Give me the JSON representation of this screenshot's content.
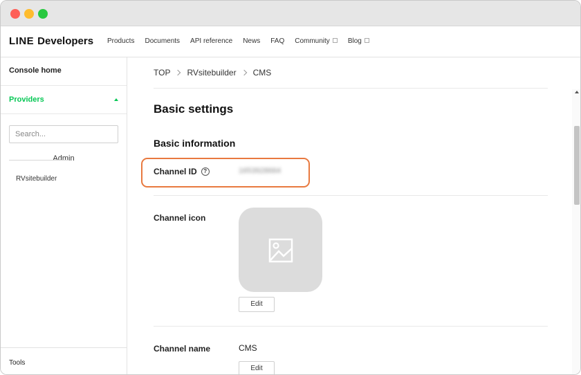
{
  "nav": {
    "logo_line": "LINE",
    "logo_dev": "Developers",
    "links": [
      "Products",
      "Documents",
      "API reference",
      "News",
      "FAQ",
      "Community",
      "Blog"
    ]
  },
  "sidebar": {
    "console_home": "Console home",
    "providers": "Providers",
    "search_placeholder": "Search...",
    "section": "Admin",
    "items": [
      "RVsitebuilder"
    ],
    "tools": "Tools"
  },
  "breadcrumb": [
    "TOP",
    "RVsitebuilder",
    "CMS"
  ],
  "page": {
    "title": "Basic settings",
    "section": "Basic information",
    "channel_id_label": "Channel ID",
    "channel_id_value": "1653928664",
    "channel_icon_label": "Channel icon",
    "edit_label": "Edit",
    "channel_name_label": "Channel name",
    "channel_name_value": "CMS"
  },
  "colors": {
    "brand_green": "#06c755",
    "highlight_orange": "#e8793f"
  }
}
